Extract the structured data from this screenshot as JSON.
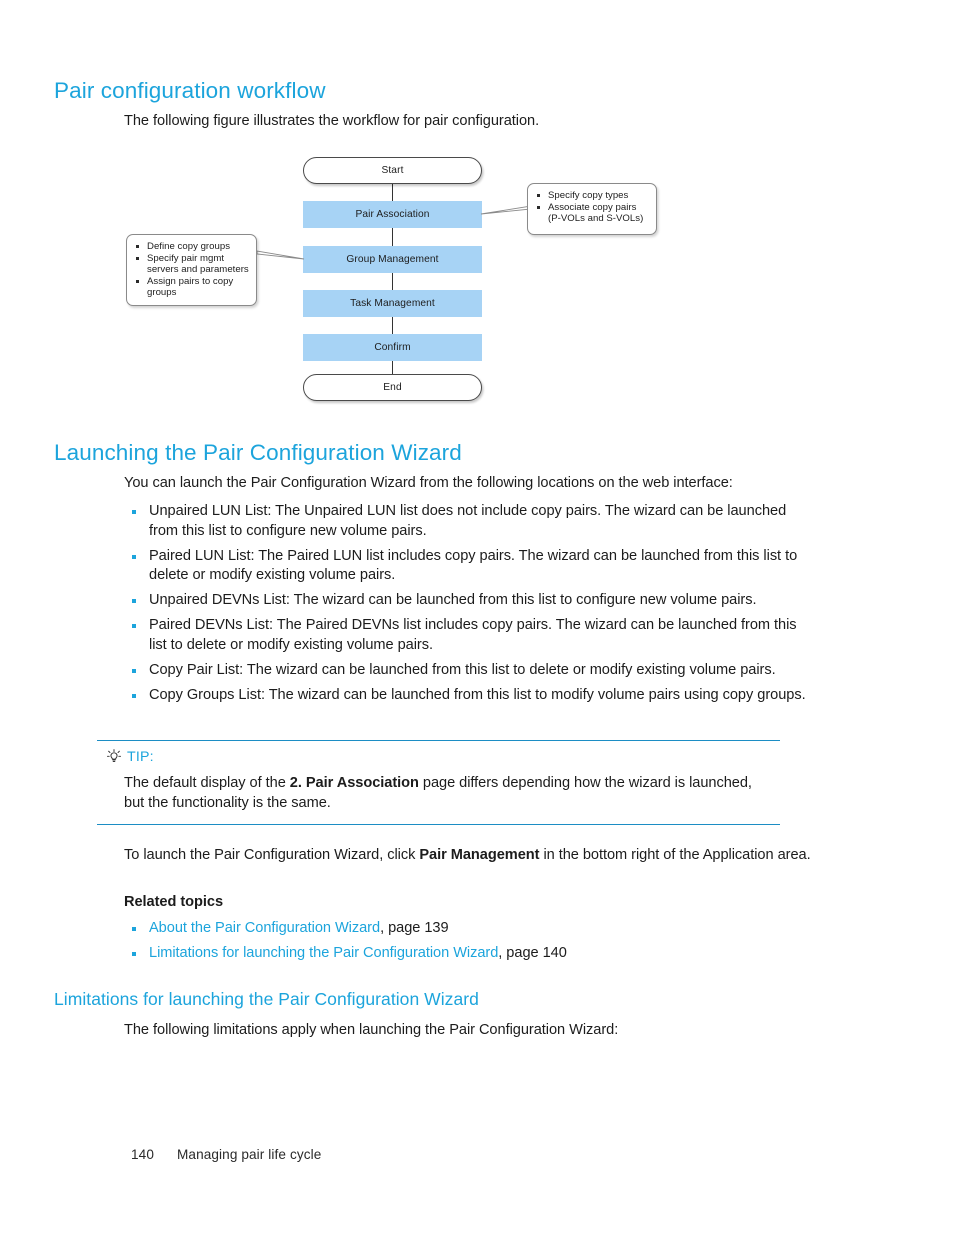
{
  "sections": {
    "workflow": {
      "heading": "Pair configuration workflow",
      "intro": "The following figure illustrates the workflow for pair configuration."
    },
    "launching": {
      "heading": "Launching the Pair Configuration Wizard",
      "intro": "You can launch the Pair Configuration Wizard from the following locations on the web interface:",
      "locations": [
        "Unpaired LUN List: The Unpaired LUN list does not include copy pairs. The wizard can be launched from this list to configure new volume pairs.",
        "Paired LUN List:  The Paired LUN list includes copy pairs. The wizard can be launched from this list to delete or modify existing volume pairs.",
        "Unpaired DEVNs List: The wizard can be launched from this list to configure new volume pairs.",
        "Paired DEVNs List: The Paired DEVNs list includes copy pairs. The wizard can be launched from this list to delete or modify existing volume pairs.",
        "Copy Pair List: The wizard can be launched from this list to delete or modify existing volume pairs.",
        "Copy Groups List: The wizard can be launched from this list to modify volume pairs using copy groups."
      ],
      "launch_note_pre": "To launch the Pair Configuration Wizard, click ",
      "launch_note_bold": "Pair Management",
      "launch_note_post": " in the bottom right of the Application area.",
      "related_topics_heading": "Related topics",
      "related_topics": [
        {
          "link": "About the Pair Configuration Wizard",
          "suffix": ", page 139"
        },
        {
          "link": "Limitations for launching the Pair Configuration Wizard",
          "suffix": ", page 140"
        }
      ]
    },
    "limitations": {
      "heading": "Limitations for launching the Pair Configuration Wizard",
      "intro": "The following limitations apply when launching the Pair Configuration Wizard:"
    }
  },
  "tip": {
    "label": "TIP:",
    "icon": "lightbulb-icon",
    "text_pre": "The default display of the ",
    "text_bold": "2. Pair Association",
    "text_post": " page differs depending how the wizard is launched, but the functionality is the same."
  },
  "flowchart": {
    "nodes": [
      {
        "id": "start",
        "label": "Start",
        "type": "terminal"
      },
      {
        "id": "pair-association",
        "label": "Pair Association",
        "type": "process"
      },
      {
        "id": "group-management",
        "label": "Group Management",
        "type": "process"
      },
      {
        "id": "task-management",
        "label": "Task Management",
        "type": "process"
      },
      {
        "id": "confirm",
        "label": "Confirm",
        "type": "process"
      },
      {
        "id": "end",
        "label": "End",
        "type": "terminal"
      }
    ],
    "callout_right": {
      "items": [
        {
          "line1": "Specify copy types",
          "line2": ""
        },
        {
          "line1": "Associate copy pairs",
          "line2": "(P-VOLs and S-VOLs)"
        }
      ]
    },
    "callout_left": {
      "items": [
        {
          "line1": "Define copy groups",
          "line2": ""
        },
        {
          "line1": "Specify pair mgmt",
          "line2": "servers and parameters"
        },
        {
          "line1": "Assign pairs to copy",
          "line2": "groups"
        }
      ]
    },
    "colors": {
      "process_fill": "#A7D3F5",
      "terminal_border": "#4a4a4a",
      "connector": "#333333"
    }
  },
  "footer": {
    "page_number": "140",
    "chapter": "Managing pair life cycle"
  },
  "theme": {
    "heading_blue": "#1CA4DC",
    "link_blue": "#1CA4DC",
    "rule_blue": "#1C8DC4",
    "body_text": "#1c1c1c"
  }
}
